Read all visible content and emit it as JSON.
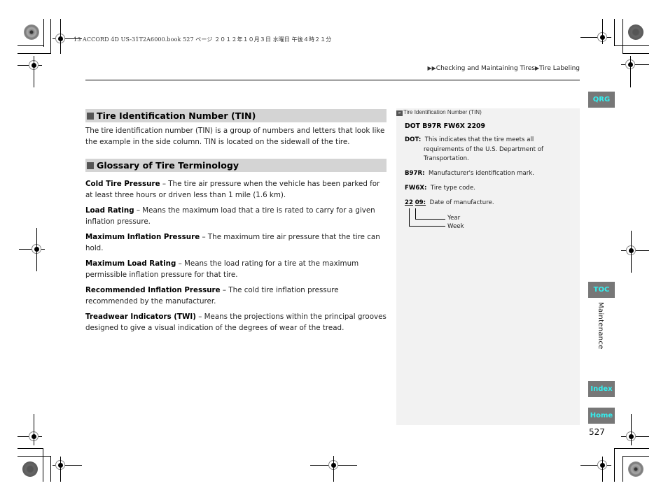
{
  "print_header": "13 ACCORD 4D US-31T2A6000.book  527 ページ  ２０１２年１０月３日  水曜日  午後４時２１分",
  "breadcrumb": {
    "prefix_icon": "double-arrow-icon",
    "items": [
      "Checking and Maintaining Tires",
      "Tire Labeling"
    ],
    "separator_icon": "arrow-right-icon"
  },
  "main": {
    "sections": [
      {
        "title": "Tire Identification Number (TIN)",
        "body": "The tire identification number (TIN) is a group of numbers and letters that look like the example in the side column. TIN is located on the sidewall of the tire."
      },
      {
        "title": "Glossary of Tire Terminology",
        "terms": [
          {
            "term": "Cold Tire Pressure",
            "definition": " – The tire air pressure when the vehicle has been parked for at least three hours or driven less than 1 mile (1.6 km)."
          },
          {
            "term": "Load Rating",
            "definition": " – Means the maximum load that a tire is rated to carry for a given inflation pressure."
          },
          {
            "term": "Maximum Inflation Pressure",
            "definition": " – The maximum tire air pressure that the tire can hold."
          },
          {
            "term": "Maximum Load Rating",
            "definition": " – Means the load rating for a tire at the maximum permissible inflation pressure for that tire."
          },
          {
            "term": "Recommended Inflation Pressure",
            "definition": " – The cold tire inflation pressure recommended by the manufacturer."
          },
          {
            "term": "Treadwear Indicators (TWI)",
            "definition": " – Means the projections within the principal grooves designed to give a visual indication of the degrees of wear of the tread."
          }
        ]
      }
    ]
  },
  "side": {
    "title": "Tire Identification Number (TIN)",
    "tin_example": "DOT B97R FW6X 2209",
    "entries": [
      {
        "key": "DOT:",
        "line1": "This indicates that the tire meets all",
        "line2": "requirements of the U.S. Department of",
        "line3": "Transportation."
      },
      {
        "key": "B97R:",
        "text": "Manufacturer's identification mark."
      },
      {
        "key": "FW6X:",
        "text": "Tire type code."
      }
    ],
    "date": {
      "week": "22",
      "year": "09:",
      "text": "Date of manufacture.",
      "year_label": "Year",
      "week_label": "Week"
    }
  },
  "nav_tabs": {
    "qrg": "QRG",
    "toc": "TOC",
    "index": "Index",
    "home": "Home",
    "chapter_label": "Maintenance",
    "tab_bg_color": "#777777",
    "tab_text_color": "#33f0f0"
  },
  "page_number": "527"
}
